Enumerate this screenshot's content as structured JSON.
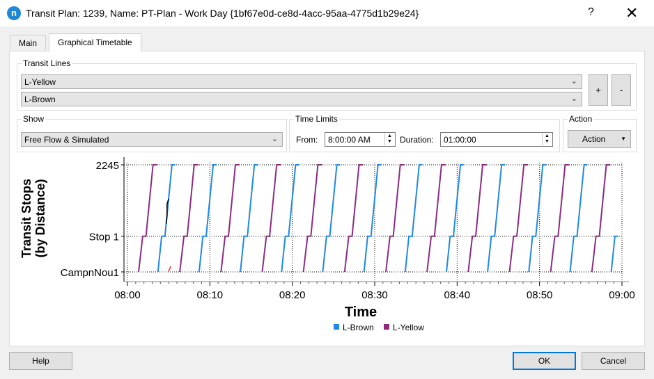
{
  "window": {
    "title": "Transit Plan: 1239, Name: PT-Plan - Work Day  {1bf67e0d-ce8d-4acc-95aa-4775d1b29e24}",
    "app_icon_letter": "n",
    "help_symbol": "?",
    "close_symbol": "✕"
  },
  "tabs": [
    {
      "label": "Main",
      "active": false
    },
    {
      "label": "Graphical Timetable",
      "active": true
    }
  ],
  "transit_lines": {
    "group_label": "Transit Lines",
    "lines": [
      "L-Yellow",
      "L-Brown"
    ],
    "add_label": "+",
    "remove_label": "-"
  },
  "show": {
    "group_label": "Show",
    "selected": "Free Flow & Simulated"
  },
  "time_limits": {
    "group_label": "Time Limits",
    "from_label": "From:",
    "from_value": "8:00:00 AM",
    "duration_label": "Duration:",
    "duration_value": "01:00:00"
  },
  "action": {
    "group_label": "Action",
    "button_label": "Action"
  },
  "footer": {
    "help_label": "Help",
    "ok_label": "OK",
    "cancel_label": "Cancel"
  },
  "colors": {
    "l_brown": "#1e88e5",
    "l_yellow": "#8e2a80",
    "simulated_red": "#e53935",
    "simulated_black": "#000000"
  },
  "chart_data": {
    "type": "line",
    "title": "",
    "xlabel": "Time",
    "ylabel": "Transit Stops\n(by Distance)",
    "ylabel_lines": [
      "Transit Stops",
      "(by Distance)"
    ],
    "x_ticks": [
      "08:00",
      "08:10",
      "08:20",
      "08:30",
      "08:40",
      "08:50",
      "09:00"
    ],
    "x_range_minutes": [
      0,
      60
    ],
    "y_stops": [
      {
        "name": "CampnNou1",
        "level": 0
      },
      {
        "name": "Stop 1",
        "level": 1
      },
      {
        "name": "2245",
        "level": 3
      }
    ],
    "grid": true,
    "legend": [
      {
        "name": "L-Brown",
        "color": "#1e88e5"
      },
      {
        "name": "L-Yellow",
        "color": "#8e2a80"
      }
    ],
    "legend_position": "bottom-center",
    "series": [
      {
        "name": "L-Yellow",
        "color": "#8e2a80",
        "headway_min": 5,
        "first_departure_min": 1.35,
        "trip_profile_min": [
          [
            0,
            0
          ],
          [
            0.5,
            1
          ],
          [
            0.9,
            1
          ],
          [
            1.75,
            3
          ],
          [
            2.25,
            3
          ]
        ],
        "trip_count": 12
      },
      {
        "name": "L-Brown",
        "color": "#1e88e5",
        "headway_min": 5,
        "first_departure_min": 3.7,
        "trip_profile_min": [
          [
            0,
            0
          ],
          [
            0.45,
            1
          ],
          [
            0.85,
            1
          ],
          [
            1.7,
            3
          ],
          [
            2.1,
            3
          ]
        ],
        "trip_count": 12
      }
    ],
    "simulated_fragments": [
      {
        "color": "#000000",
        "points": [
          [
            4.7,
            1.35
          ],
          [
            4.8,
            1.55
          ],
          [
            4.8,
            1.9
          ],
          [
            5.0,
            2.05
          ]
        ]
      },
      {
        "color": "#e53935",
        "points": [
          [
            4.95,
            0.02
          ],
          [
            5.1,
            0.06
          ],
          [
            5.25,
            0.16
          ]
        ]
      }
    ]
  }
}
